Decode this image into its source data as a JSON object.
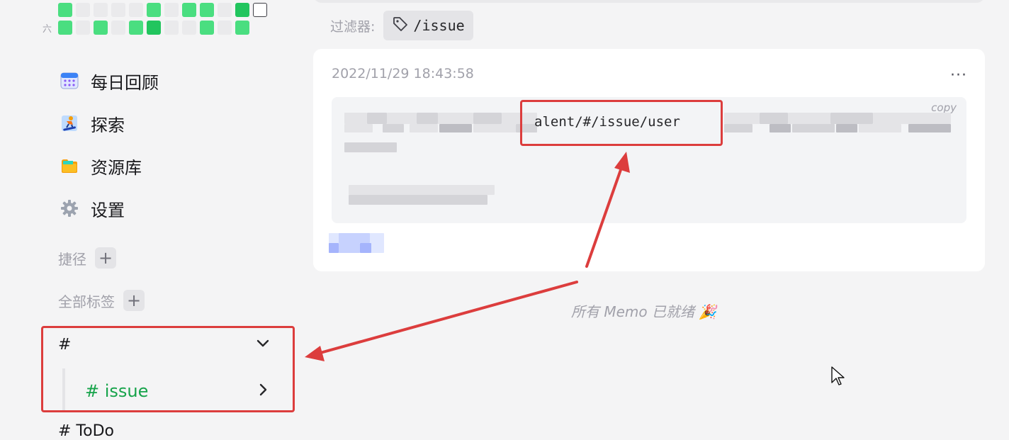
{
  "heatmap": {
    "day_label": "六",
    "top_row": [
      1,
      0,
      0,
      0,
      0,
      1,
      0,
      1,
      1,
      0,
      2,
      3
    ],
    "bottom_row": [
      1,
      0,
      1,
      0,
      1,
      2,
      0,
      0,
      1,
      0,
      1
    ]
  },
  "nav": {
    "items": [
      {
        "label": "每日回顾",
        "icon": "calendar-icon"
      },
      {
        "label": "探索",
        "icon": "snowboarder-icon"
      },
      {
        "label": "资源库",
        "icon": "folder-icon"
      },
      {
        "label": "设置",
        "icon": "gear-icon"
      }
    ]
  },
  "shortcuts": {
    "title": "捷径",
    "add_label": "+"
  },
  "tags_section": {
    "title": "全部标签",
    "add_label": "+"
  },
  "tags": {
    "root_label": "#",
    "child_label": "# issue",
    "next_label": "# ToDo"
  },
  "filter": {
    "label": "过滤器:",
    "value": "/issue",
    "icon": "tag-icon"
  },
  "memo": {
    "timestamp": "2022/11/29 18:43:58",
    "more_label": "···",
    "copy_label": "copy",
    "visible_code": "alent/#/issue/user"
  },
  "footer": {
    "status": "所有 Memo 已就绪 🎉"
  },
  "annotations": {
    "box_color": "#dc3d3d",
    "arrow_color": "#dc3d3d"
  },
  "colors": {
    "accent_green": "#16a34a",
    "heat_light": "#4ade80",
    "heat_dark": "#22c55e"
  }
}
